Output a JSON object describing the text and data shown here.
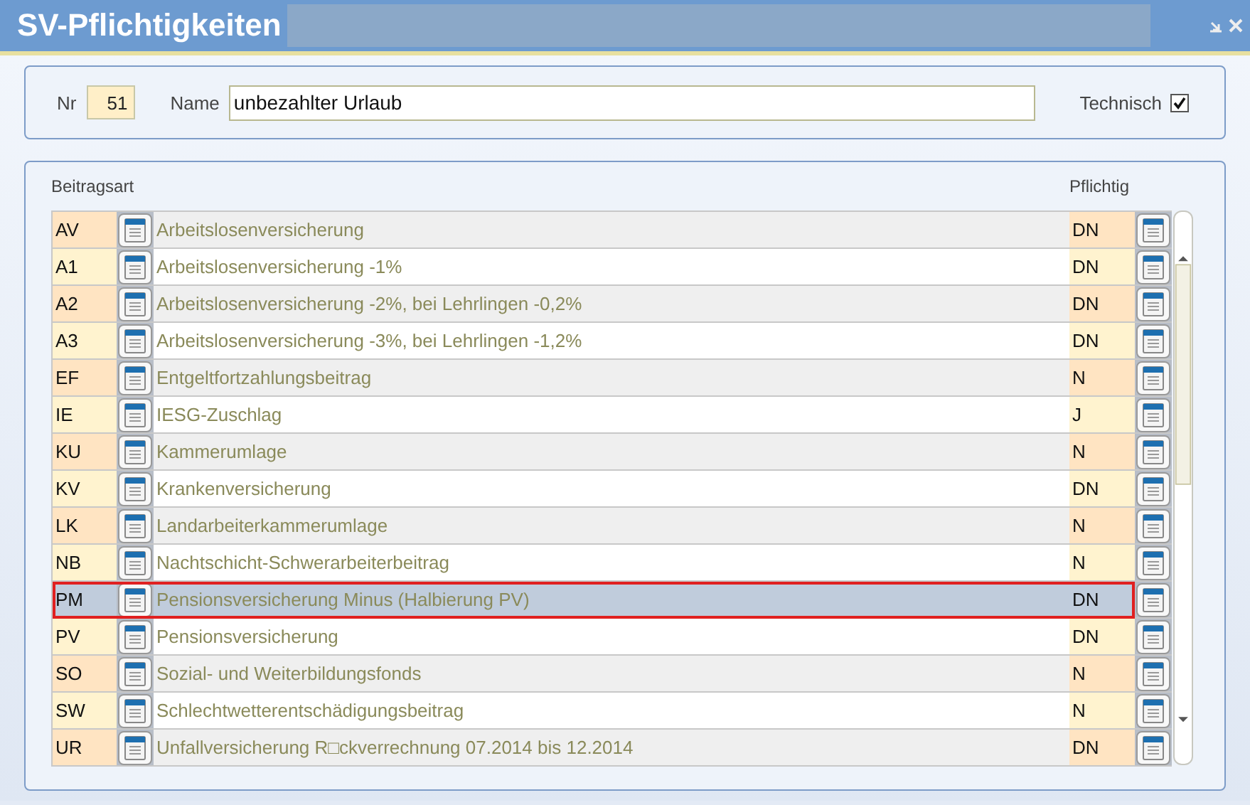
{
  "window": {
    "title": "SV-Pflichtigkeiten"
  },
  "form": {
    "nr_label": "Nr",
    "nr": "51",
    "name_label": "Name",
    "name": "unbezahlter Urlaub",
    "technisch_label": "Technisch",
    "technisch": true
  },
  "table": {
    "columns": [
      "Beitragsart",
      "Pflichtig"
    ],
    "rows": [
      {
        "code": "AV",
        "name": "Arbeitslosenversicherung",
        "pflichtig": "DN",
        "selected": false
      },
      {
        "code": "A1",
        "name": "Arbeitslosenversicherung -1%",
        "pflichtig": "DN",
        "selected": false
      },
      {
        "code": "A2",
        "name": "Arbeitslosenversicherung -2%, bei Lehrlingen -0,2%",
        "pflichtig": "DN",
        "selected": false
      },
      {
        "code": "A3",
        "name": "Arbeitslosenversicherung -3%, bei Lehrlingen -1,2%",
        "pflichtig": "DN",
        "selected": false
      },
      {
        "code": "EF",
        "name": "Entgeltfortzahlungsbeitrag",
        "pflichtig": "N",
        "selected": false
      },
      {
        "code": "IE",
        "name": "IESG-Zuschlag",
        "pflichtig": "J",
        "selected": false
      },
      {
        "code": "KU",
        "name": "Kammerumlage",
        "pflichtig": "N",
        "selected": false
      },
      {
        "code": "KV",
        "name": "Krankenversicherung",
        "pflichtig": "DN",
        "selected": false
      },
      {
        "code": "LK",
        "name": "Landarbeiterkammerumlage",
        "pflichtig": "N",
        "selected": false
      },
      {
        "code": "NB",
        "name": "Nachtschicht-Schwerarbeiterbeitrag",
        "pflichtig": "N",
        "selected": false
      },
      {
        "code": "PM",
        "name": "Pensionsversicherung Minus (Halbierung PV)",
        "pflichtig": "DN",
        "selected": true
      },
      {
        "code": "PV",
        "name": "Pensionsversicherung",
        "pflichtig": "DN",
        "selected": false
      },
      {
        "code": "SO",
        "name": "Sozial- und Weiterbildungsfonds",
        "pflichtig": "N",
        "selected": false
      },
      {
        "code": "SW",
        "name": "Schlechtwetterentschädigungsbeitrag",
        "pflichtig": "N",
        "selected": false
      },
      {
        "code": "UR",
        "name": "Unfallversicherung R□ckverrechnung 07.2014 bis 12.2014",
        "pflichtig": "DN",
        "selected": false
      }
    ]
  }
}
